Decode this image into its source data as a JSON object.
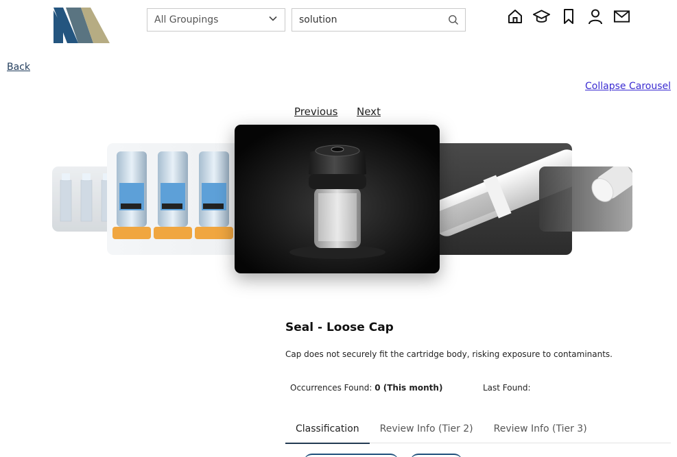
{
  "header": {
    "grouping_select": {
      "selected": "All Groupings"
    },
    "search": {
      "value": "solution"
    },
    "icons": [
      "home-icon",
      "graduation-cap-icon",
      "bookmark-icon",
      "user-icon",
      "mail-icon"
    ]
  },
  "nav": {
    "back_label": "Back",
    "collapse_label": "Collapse Carousel"
  },
  "carousel": {
    "previous_label": "Previous",
    "next_label": "Next",
    "selected_index": 2,
    "slides": 5
  },
  "detail": {
    "title": "Seal - Loose Cap",
    "description": "Cap does not securely fit the cartridge body, risking exposure to contaminants.",
    "occurrences_label": "Occurrences Found:",
    "occurrences_value": "0 (This month)",
    "last_found_label": "Last Found:",
    "last_found_value": ""
  },
  "tabs": [
    {
      "label": "Classification",
      "active": true
    },
    {
      "label": "Review Info (Tier 2)",
      "active": false
    },
    {
      "label": "Review Info (Tier 3)",
      "active": false
    }
  ],
  "colors": {
    "link_back": "#1f3a5a",
    "link_collapse": "#3a2bd1",
    "tab_active_underline": "#223a52",
    "logo_blue": "#24557f",
    "logo_slate": "#5a7481",
    "logo_tan": "#b6ac83"
  }
}
